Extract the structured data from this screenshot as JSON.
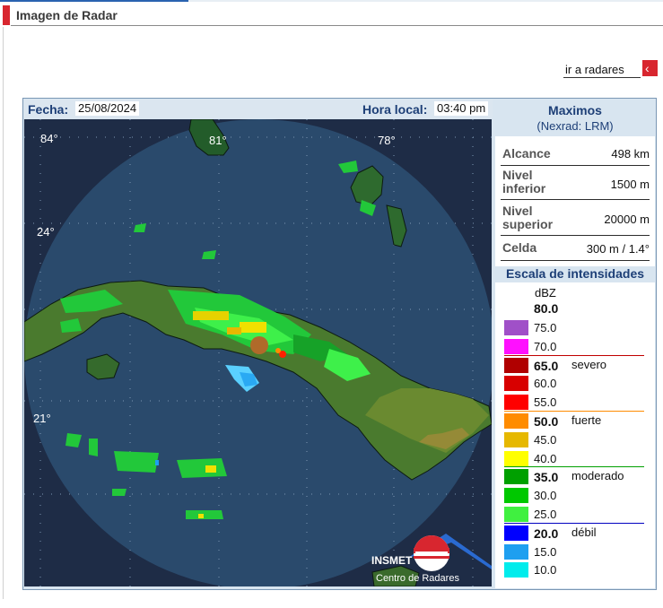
{
  "header": {
    "title": "Imagen de Radar"
  },
  "nav": {
    "link_label": "ir a radares",
    "back_icon": "chevron-left-icon"
  },
  "map": {
    "fecha_label": "Fecha:",
    "fecha_value": "25/08/2024",
    "hora_label": "Hora local:",
    "hora_value": "03:40 pm",
    "lon_labels": [
      "84°",
      "81°",
      "78°"
    ],
    "lat_labels": [
      "24°",
      "21°"
    ],
    "logo_text": "INSMET",
    "logo_caption": "Centro de Radares"
  },
  "info": {
    "title": "Maximos",
    "subtitle": "(Nexrad: LRM)",
    "rows": [
      {
        "k1": "Alcance",
        "k2": "",
        "value": "498 km"
      },
      {
        "k1": "Nivel",
        "k2": "inferior",
        "value": "1500 m"
      },
      {
        "k1": "Nivel",
        "k2": "superior",
        "value": "20000 m"
      },
      {
        "k1": "Celda",
        "k2": "",
        "value": "300 m / 1.4°"
      }
    ]
  },
  "scale": {
    "title": "Escala de intensidades",
    "unit": "dBZ",
    "max": "80.0",
    "levels": [
      {
        "value": "75.0",
        "color": "#a050c8",
        "bold": false,
        "cat": ""
      },
      {
        "value": "70.0",
        "color": "#ff10ff",
        "bold": false,
        "cat": ""
      },
      {
        "value": "65.0",
        "color": "#b00000",
        "bold": true,
        "cat": "severo",
        "sep": "#c00000"
      },
      {
        "value": "60.0",
        "color": "#d80000",
        "bold": false,
        "cat": ""
      },
      {
        "value": "55.0",
        "color": "#ff0000",
        "bold": false,
        "cat": ""
      },
      {
        "value": "50.0",
        "color": "#ff8c00",
        "bold": true,
        "cat": "fuerte",
        "sep": "#ff8c00"
      },
      {
        "value": "45.0",
        "color": "#e6b800",
        "bold": false,
        "cat": ""
      },
      {
        "value": "40.0",
        "color": "#ffff00",
        "bold": false,
        "cat": ""
      },
      {
        "value": "35.0",
        "color": "#00a000",
        "bold": true,
        "cat": "moderado",
        "sep": "#00a000"
      },
      {
        "value": "30.0",
        "color": "#00c800",
        "bold": false,
        "cat": ""
      },
      {
        "value": "25.0",
        "color": "#40f040",
        "bold": false,
        "cat": ""
      },
      {
        "value": "20.0",
        "color": "#0000ff",
        "bold": true,
        "cat": "débil",
        "sep": "#0000c0"
      },
      {
        "value": "15.0",
        "color": "#1e9ff0",
        "bold": false,
        "cat": ""
      },
      {
        "value": "10.0",
        "color": "#00ecec",
        "bold": false,
        "cat": ""
      }
    ]
  }
}
